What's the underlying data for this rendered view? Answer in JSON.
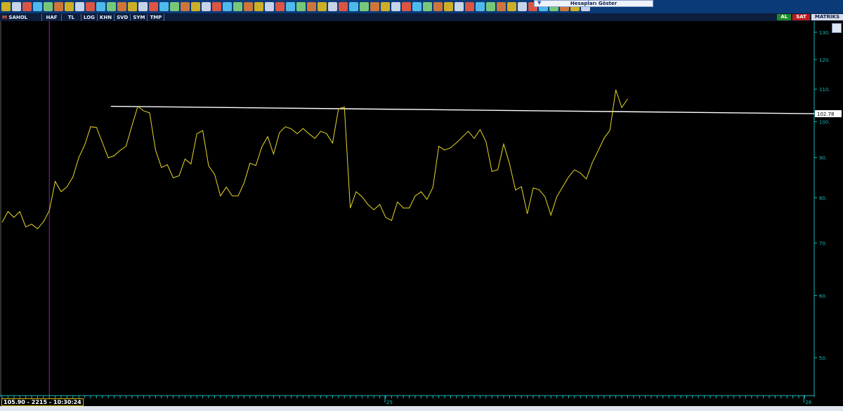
{
  "window": {
    "hesap_button": "Hesapları Göster",
    "symbol_letter": "M",
    "symbol": "SAHOL"
  },
  "tabs": [
    "HAF",
    "TL",
    "LOG",
    "KHN",
    "SVD",
    "SYM",
    "TMP"
  ],
  "right_tabs": {
    "buy": "AL",
    "sell": "SAT",
    "matrix": "MATRİKS"
  },
  "status_text": "105.90 - 2215 - 10:30:24",
  "colors": {
    "background": "#000000",
    "price_line": "#e8d826",
    "trend_line": "#ffffff",
    "axis": "#18b8b8",
    "marker": "#8b2a9e"
  },
  "chart_data": {
    "type": "line",
    "y_scale": "log",
    "y_ticks": [
      130,
      120,
      110,
      100,
      90,
      80,
      70,
      60,
      50
    ],
    "y_tick_labels": [
      "130.",
      "120.",
      "110.",
      "100.",
      "90.",
      "80.",
      "70.",
      "60.",
      "50."
    ],
    "x_ticks": [
      {
        "index": 65,
        "label": "25"
      },
      {
        "index": 136,
        "label": "26"
      }
    ],
    "last_price_label": "102.78",
    "series": [
      {
        "values": [
          74.4,
          76.8,
          75.5,
          76.8,
          73.4,
          74,
          73,
          74.5,
          77,
          83.9,
          81.4,
          82.6,
          85,
          90,
          93.4,
          98.5,
          98.3,
          94,
          89.9,
          90.5,
          91.9,
          93,
          98.8,
          104.6,
          103.2,
          102.6,
          92,
          87.4,
          88.1,
          84.8,
          85.3,
          89.6,
          88.3,
          96.5,
          97.4,
          87.8,
          85.7,
          80.4,
          82.5,
          80.4,
          80.4,
          83.5,
          88.5,
          87.9,
          92.8,
          95.7,
          90.9,
          96.8,
          98.5,
          97.9,
          96.5,
          98,
          96.5,
          95.2,
          97.2,
          96.5,
          93.9,
          103.8,
          104.4,
          77.6,
          81.4,
          80.2,
          78.4,
          77.2,
          78.4,
          75.5,
          74.8,
          79,
          77.6,
          77.6,
          80.4,
          81.4,
          79.6,
          82.4,
          93,
          92,
          92.6,
          94,
          95.6,
          97.2,
          95.2,
          97.7,
          94.3,
          86.4,
          86.8,
          93.6,
          88.3,
          81.8,
          82.6,
          76.3,
          82.3,
          81.9,
          80.2,
          76,
          80.2,
          82.6,
          85,
          86.8,
          86,
          84.5,
          88.6,
          91.8,
          95.2,
          97.5,
          109.8,
          104.2,
          106.9
        ]
      }
    ],
    "trendline": {
      "from": {
        "index": 22,
        "value": 104.6
      },
      "to": {
        "index": 145,
        "value": 102.78
      }
    },
    "markers": [
      {
        "index": 8
      }
    ]
  }
}
